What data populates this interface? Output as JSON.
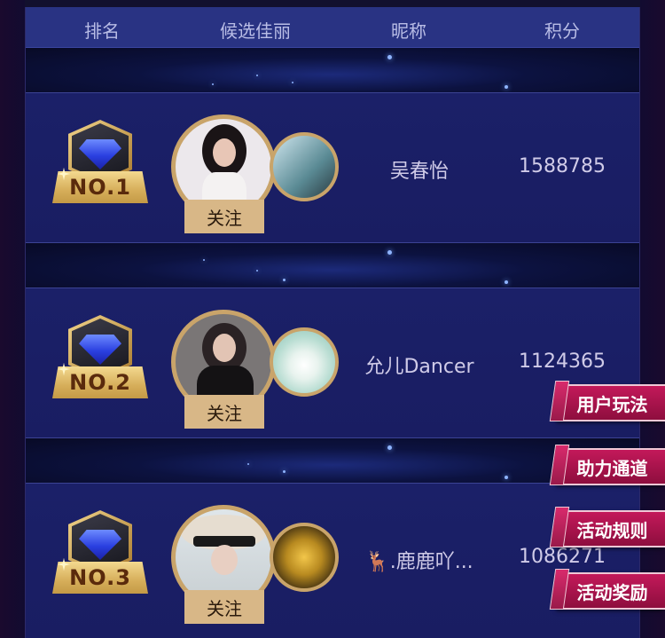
{
  "header": {
    "col_rank": "排名",
    "col_candidate": "候选佳丽",
    "col_nickname": "昵称",
    "col_score": "积分"
  },
  "rows": [
    {
      "rank": "NO.1",
      "follow": "关注",
      "nickname": "吴春怡",
      "score": "1588785"
    },
    {
      "rank": "NO.2",
      "follow": "关注",
      "nickname": "允儿Dancer",
      "score": "1124365"
    },
    {
      "rank": "NO.3",
      "follow": "关注",
      "nickname": "🦌.鹿鹿吖...",
      "score": "1086271"
    }
  ],
  "side_menu": {
    "play": "用户玩法",
    "assist": "助力通道",
    "rules": "活动规则",
    "rewards": "活动奖励"
  },
  "colors": {
    "header_bg": "#293383",
    "row_bg": "#1b2068",
    "gold": "#d8b787",
    "side_button": "#c3195a"
  },
  "icons": [
    "diamond-rank-badge-icon",
    "sparkle-icon"
  ]
}
